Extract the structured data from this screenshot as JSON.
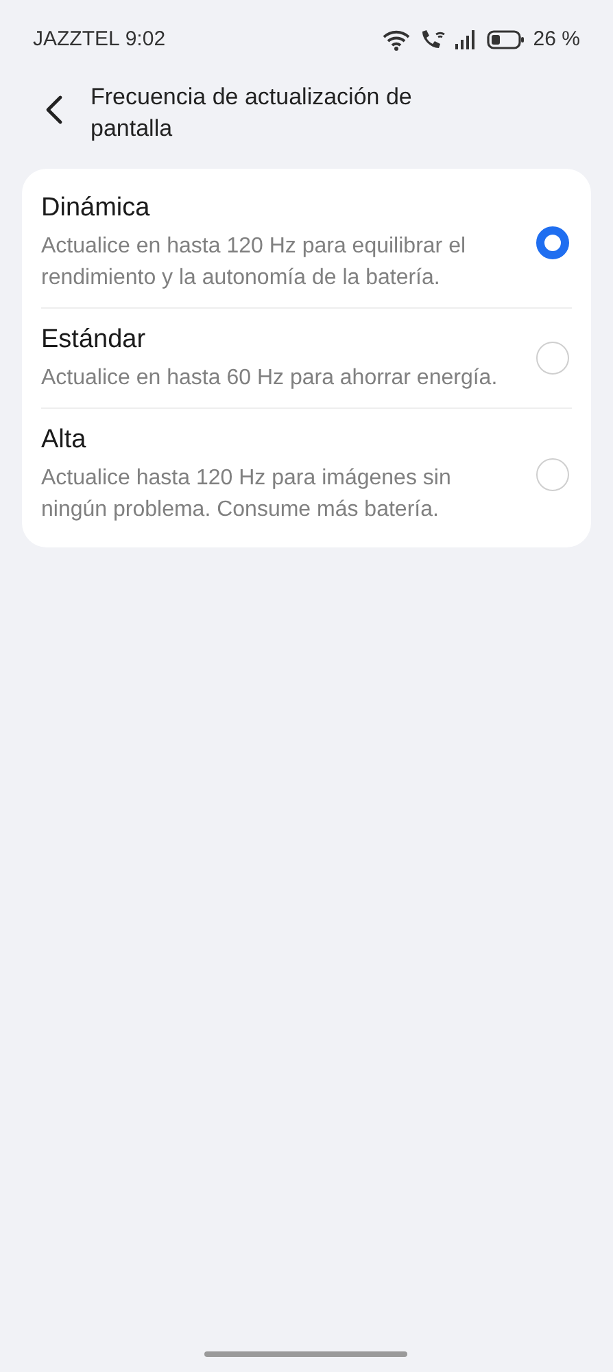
{
  "status_bar": {
    "carrier": "JAZZTEL",
    "time": "9:02",
    "battery": "26 %"
  },
  "header": {
    "title": "Frecuencia de actualización de pantalla"
  },
  "options": [
    {
      "title": "Dinámica",
      "description": "Actualice en hasta 120 Hz para equilibrar el rendimiento y la autonomía de la batería.",
      "selected": true
    },
    {
      "title": "Estándar",
      "description": "Actualice en hasta 60 Hz para ahorrar energía.",
      "selected": false
    },
    {
      "title": "Alta",
      "description": "Actualice hasta 120 Hz para imágenes sin ningún problema. Consume más batería.",
      "selected": false
    }
  ]
}
